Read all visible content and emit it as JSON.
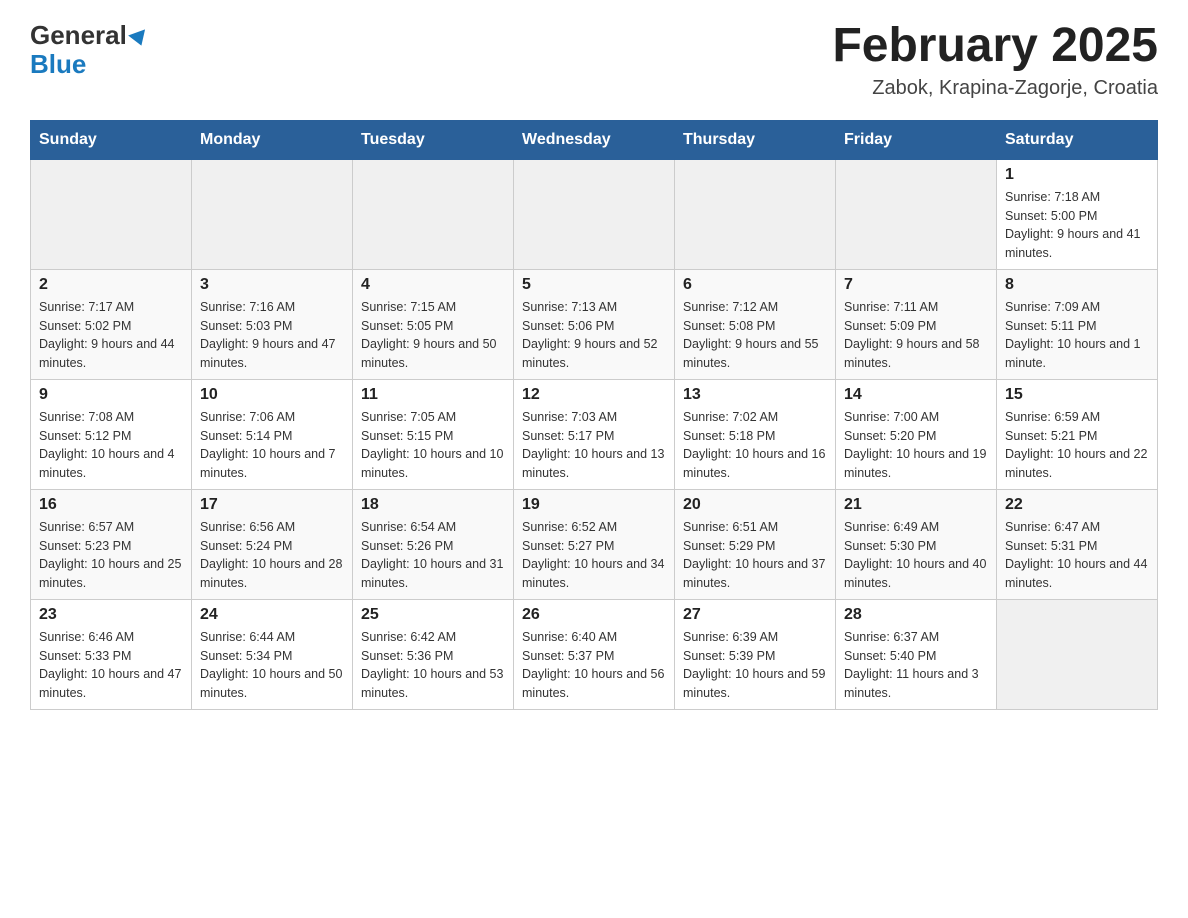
{
  "header": {
    "logo_general": "General",
    "logo_blue": "Blue",
    "month_title": "February 2025",
    "location": "Zabok, Krapina-Zagorje, Croatia"
  },
  "days_of_week": [
    "Sunday",
    "Monday",
    "Tuesday",
    "Wednesday",
    "Thursday",
    "Friday",
    "Saturday"
  ],
  "weeks": [
    {
      "days": [
        {
          "num": "",
          "info": ""
        },
        {
          "num": "",
          "info": ""
        },
        {
          "num": "",
          "info": ""
        },
        {
          "num": "",
          "info": ""
        },
        {
          "num": "",
          "info": ""
        },
        {
          "num": "",
          "info": ""
        },
        {
          "num": "1",
          "info": "Sunrise: 7:18 AM\nSunset: 5:00 PM\nDaylight: 9 hours and 41 minutes."
        }
      ]
    },
    {
      "days": [
        {
          "num": "2",
          "info": "Sunrise: 7:17 AM\nSunset: 5:02 PM\nDaylight: 9 hours and 44 minutes."
        },
        {
          "num": "3",
          "info": "Sunrise: 7:16 AM\nSunset: 5:03 PM\nDaylight: 9 hours and 47 minutes."
        },
        {
          "num": "4",
          "info": "Sunrise: 7:15 AM\nSunset: 5:05 PM\nDaylight: 9 hours and 50 minutes."
        },
        {
          "num": "5",
          "info": "Sunrise: 7:13 AM\nSunset: 5:06 PM\nDaylight: 9 hours and 52 minutes."
        },
        {
          "num": "6",
          "info": "Sunrise: 7:12 AM\nSunset: 5:08 PM\nDaylight: 9 hours and 55 minutes."
        },
        {
          "num": "7",
          "info": "Sunrise: 7:11 AM\nSunset: 5:09 PM\nDaylight: 9 hours and 58 minutes."
        },
        {
          "num": "8",
          "info": "Sunrise: 7:09 AM\nSunset: 5:11 PM\nDaylight: 10 hours and 1 minute."
        }
      ]
    },
    {
      "days": [
        {
          "num": "9",
          "info": "Sunrise: 7:08 AM\nSunset: 5:12 PM\nDaylight: 10 hours and 4 minutes."
        },
        {
          "num": "10",
          "info": "Sunrise: 7:06 AM\nSunset: 5:14 PM\nDaylight: 10 hours and 7 minutes."
        },
        {
          "num": "11",
          "info": "Sunrise: 7:05 AM\nSunset: 5:15 PM\nDaylight: 10 hours and 10 minutes."
        },
        {
          "num": "12",
          "info": "Sunrise: 7:03 AM\nSunset: 5:17 PM\nDaylight: 10 hours and 13 minutes."
        },
        {
          "num": "13",
          "info": "Sunrise: 7:02 AM\nSunset: 5:18 PM\nDaylight: 10 hours and 16 minutes."
        },
        {
          "num": "14",
          "info": "Sunrise: 7:00 AM\nSunset: 5:20 PM\nDaylight: 10 hours and 19 minutes."
        },
        {
          "num": "15",
          "info": "Sunrise: 6:59 AM\nSunset: 5:21 PM\nDaylight: 10 hours and 22 minutes."
        }
      ]
    },
    {
      "days": [
        {
          "num": "16",
          "info": "Sunrise: 6:57 AM\nSunset: 5:23 PM\nDaylight: 10 hours and 25 minutes."
        },
        {
          "num": "17",
          "info": "Sunrise: 6:56 AM\nSunset: 5:24 PM\nDaylight: 10 hours and 28 minutes."
        },
        {
          "num": "18",
          "info": "Sunrise: 6:54 AM\nSunset: 5:26 PM\nDaylight: 10 hours and 31 minutes."
        },
        {
          "num": "19",
          "info": "Sunrise: 6:52 AM\nSunset: 5:27 PM\nDaylight: 10 hours and 34 minutes."
        },
        {
          "num": "20",
          "info": "Sunrise: 6:51 AM\nSunset: 5:29 PM\nDaylight: 10 hours and 37 minutes."
        },
        {
          "num": "21",
          "info": "Sunrise: 6:49 AM\nSunset: 5:30 PM\nDaylight: 10 hours and 40 minutes."
        },
        {
          "num": "22",
          "info": "Sunrise: 6:47 AM\nSunset: 5:31 PM\nDaylight: 10 hours and 44 minutes."
        }
      ]
    },
    {
      "days": [
        {
          "num": "23",
          "info": "Sunrise: 6:46 AM\nSunset: 5:33 PM\nDaylight: 10 hours and 47 minutes."
        },
        {
          "num": "24",
          "info": "Sunrise: 6:44 AM\nSunset: 5:34 PM\nDaylight: 10 hours and 50 minutes."
        },
        {
          "num": "25",
          "info": "Sunrise: 6:42 AM\nSunset: 5:36 PM\nDaylight: 10 hours and 53 minutes."
        },
        {
          "num": "26",
          "info": "Sunrise: 6:40 AM\nSunset: 5:37 PM\nDaylight: 10 hours and 56 minutes."
        },
        {
          "num": "27",
          "info": "Sunrise: 6:39 AM\nSunset: 5:39 PM\nDaylight: 10 hours and 59 minutes."
        },
        {
          "num": "28",
          "info": "Sunrise: 6:37 AM\nSunset: 5:40 PM\nDaylight: 11 hours and 3 minutes."
        },
        {
          "num": "",
          "info": ""
        }
      ]
    }
  ]
}
